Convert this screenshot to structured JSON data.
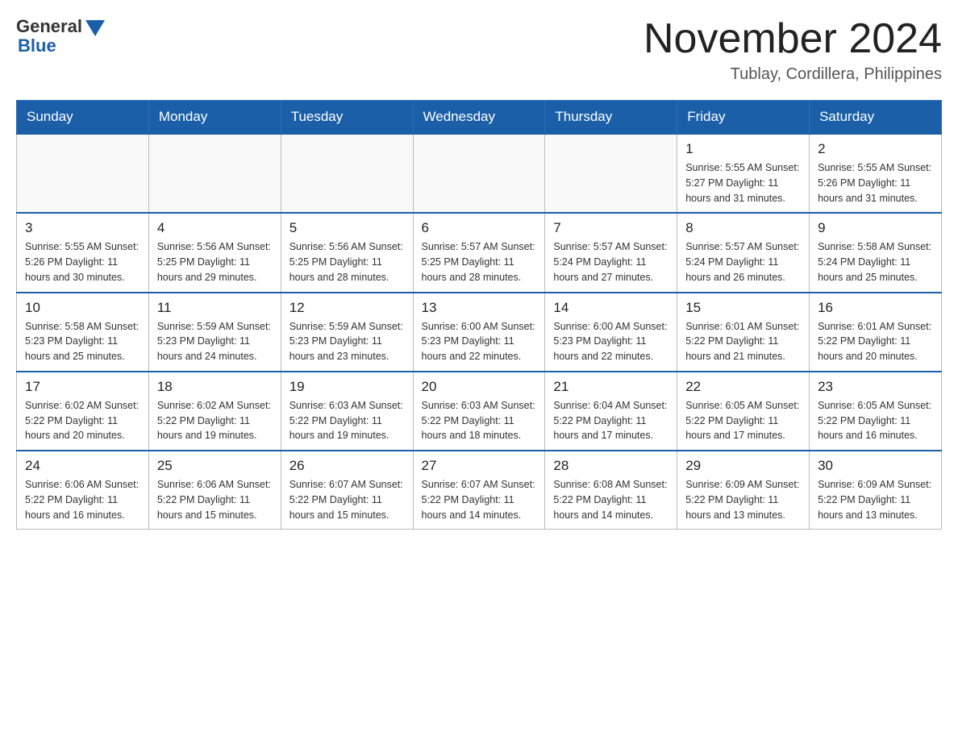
{
  "header": {
    "logo_general": "General",
    "logo_blue": "Blue",
    "month_title": "November 2024",
    "location": "Tublay, Cordillera, Philippines"
  },
  "days_of_week": [
    "Sunday",
    "Monday",
    "Tuesday",
    "Wednesday",
    "Thursday",
    "Friday",
    "Saturday"
  ],
  "weeks": [
    [
      {
        "day": "",
        "info": ""
      },
      {
        "day": "",
        "info": ""
      },
      {
        "day": "",
        "info": ""
      },
      {
        "day": "",
        "info": ""
      },
      {
        "day": "",
        "info": ""
      },
      {
        "day": "1",
        "info": "Sunrise: 5:55 AM\nSunset: 5:27 PM\nDaylight: 11 hours and 31 minutes."
      },
      {
        "day": "2",
        "info": "Sunrise: 5:55 AM\nSunset: 5:26 PM\nDaylight: 11 hours and 31 minutes."
      }
    ],
    [
      {
        "day": "3",
        "info": "Sunrise: 5:55 AM\nSunset: 5:26 PM\nDaylight: 11 hours and 30 minutes."
      },
      {
        "day": "4",
        "info": "Sunrise: 5:56 AM\nSunset: 5:25 PM\nDaylight: 11 hours and 29 minutes."
      },
      {
        "day": "5",
        "info": "Sunrise: 5:56 AM\nSunset: 5:25 PM\nDaylight: 11 hours and 28 minutes."
      },
      {
        "day": "6",
        "info": "Sunrise: 5:57 AM\nSunset: 5:25 PM\nDaylight: 11 hours and 28 minutes."
      },
      {
        "day": "7",
        "info": "Sunrise: 5:57 AM\nSunset: 5:24 PM\nDaylight: 11 hours and 27 minutes."
      },
      {
        "day": "8",
        "info": "Sunrise: 5:57 AM\nSunset: 5:24 PM\nDaylight: 11 hours and 26 minutes."
      },
      {
        "day": "9",
        "info": "Sunrise: 5:58 AM\nSunset: 5:24 PM\nDaylight: 11 hours and 25 minutes."
      }
    ],
    [
      {
        "day": "10",
        "info": "Sunrise: 5:58 AM\nSunset: 5:23 PM\nDaylight: 11 hours and 25 minutes."
      },
      {
        "day": "11",
        "info": "Sunrise: 5:59 AM\nSunset: 5:23 PM\nDaylight: 11 hours and 24 minutes."
      },
      {
        "day": "12",
        "info": "Sunrise: 5:59 AM\nSunset: 5:23 PM\nDaylight: 11 hours and 23 minutes."
      },
      {
        "day": "13",
        "info": "Sunrise: 6:00 AM\nSunset: 5:23 PM\nDaylight: 11 hours and 22 minutes."
      },
      {
        "day": "14",
        "info": "Sunrise: 6:00 AM\nSunset: 5:23 PM\nDaylight: 11 hours and 22 minutes."
      },
      {
        "day": "15",
        "info": "Sunrise: 6:01 AM\nSunset: 5:22 PM\nDaylight: 11 hours and 21 minutes."
      },
      {
        "day": "16",
        "info": "Sunrise: 6:01 AM\nSunset: 5:22 PM\nDaylight: 11 hours and 20 minutes."
      }
    ],
    [
      {
        "day": "17",
        "info": "Sunrise: 6:02 AM\nSunset: 5:22 PM\nDaylight: 11 hours and 20 minutes."
      },
      {
        "day": "18",
        "info": "Sunrise: 6:02 AM\nSunset: 5:22 PM\nDaylight: 11 hours and 19 minutes."
      },
      {
        "day": "19",
        "info": "Sunrise: 6:03 AM\nSunset: 5:22 PM\nDaylight: 11 hours and 19 minutes."
      },
      {
        "day": "20",
        "info": "Sunrise: 6:03 AM\nSunset: 5:22 PM\nDaylight: 11 hours and 18 minutes."
      },
      {
        "day": "21",
        "info": "Sunrise: 6:04 AM\nSunset: 5:22 PM\nDaylight: 11 hours and 17 minutes."
      },
      {
        "day": "22",
        "info": "Sunrise: 6:05 AM\nSunset: 5:22 PM\nDaylight: 11 hours and 17 minutes."
      },
      {
        "day": "23",
        "info": "Sunrise: 6:05 AM\nSunset: 5:22 PM\nDaylight: 11 hours and 16 minutes."
      }
    ],
    [
      {
        "day": "24",
        "info": "Sunrise: 6:06 AM\nSunset: 5:22 PM\nDaylight: 11 hours and 16 minutes."
      },
      {
        "day": "25",
        "info": "Sunrise: 6:06 AM\nSunset: 5:22 PM\nDaylight: 11 hours and 15 minutes."
      },
      {
        "day": "26",
        "info": "Sunrise: 6:07 AM\nSunset: 5:22 PM\nDaylight: 11 hours and 15 minutes."
      },
      {
        "day": "27",
        "info": "Sunrise: 6:07 AM\nSunset: 5:22 PM\nDaylight: 11 hours and 14 minutes."
      },
      {
        "day": "28",
        "info": "Sunrise: 6:08 AM\nSunset: 5:22 PM\nDaylight: 11 hours and 14 minutes."
      },
      {
        "day": "29",
        "info": "Sunrise: 6:09 AM\nSunset: 5:22 PM\nDaylight: 11 hours and 13 minutes."
      },
      {
        "day": "30",
        "info": "Sunrise: 6:09 AM\nSunset: 5:22 PM\nDaylight: 11 hours and 13 minutes."
      }
    ]
  ]
}
